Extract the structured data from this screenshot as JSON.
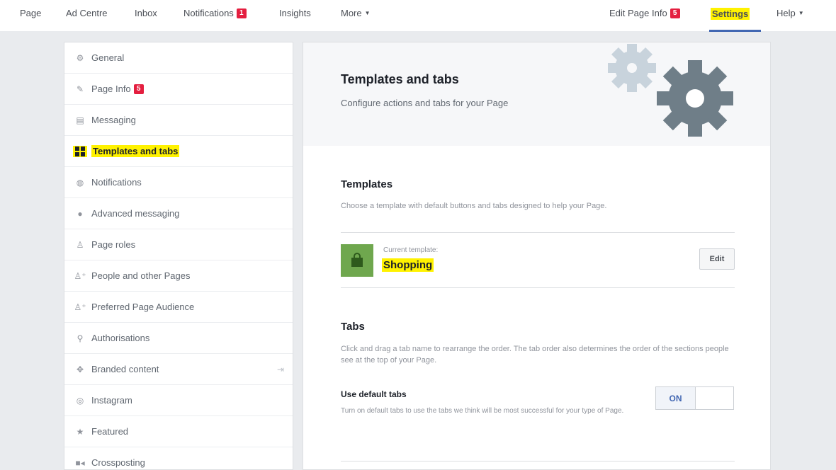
{
  "topnav": {
    "page": "Page",
    "ad_centre": "Ad Centre",
    "inbox": "Inbox",
    "notifications": "Notifications",
    "notifications_badge": "1",
    "insights": "Insights",
    "more": "More",
    "edit_page_info": "Edit Page Info",
    "edit_page_info_badge": "5",
    "settings": "Settings",
    "help": "Help"
  },
  "sidebar": {
    "items": [
      {
        "label": "General",
        "icon": "gear-icon"
      },
      {
        "label": "Page Info",
        "icon": "pencil-icon",
        "badge": "5"
      },
      {
        "label": "Messaging",
        "icon": "messaging-icon"
      },
      {
        "label": "Templates and tabs",
        "icon": "grid-icon",
        "active": true
      },
      {
        "label": "Notifications",
        "icon": "globe-icon"
      },
      {
        "label": "Advanced messaging",
        "icon": "chat-bubble-icon"
      },
      {
        "label": "Page roles",
        "icon": "person-icon"
      },
      {
        "label": "People and other Pages",
        "icon": "person-plus-icon"
      },
      {
        "label": "Preferred Page Audience",
        "icon": "person-plus-icon"
      },
      {
        "label": "Authorisations",
        "icon": "wrench-icon"
      },
      {
        "label": "Branded content",
        "icon": "handshake-icon"
      },
      {
        "label": "Instagram",
        "icon": "instagram-icon"
      },
      {
        "label": "Featured",
        "icon": "star-icon"
      },
      {
        "label": "Crossposting",
        "icon": "video-camera-icon"
      }
    ]
  },
  "main": {
    "title": "Templates and tabs",
    "subtitle": "Configure actions and tabs for your Page",
    "templates": {
      "title": "Templates",
      "description": "Choose a template with default buttons and tabs designed to help your Page.",
      "current_caption": "Current template:",
      "current_name": "Shopping",
      "edit_label": "Edit"
    },
    "tabs": {
      "title": "Tabs",
      "description": "Click and drag a tab name to rearrange the order. The tab order also determines the order of the sections people see at the top of your Page.",
      "default_label": "Use default tabs",
      "default_description": "Turn on default tabs to use the tabs we think will be most successful for your type of Page.",
      "toggle_state": "ON"
    }
  },
  "colors": {
    "highlight": "#fff200",
    "badge": "#e41e3f",
    "accent": "#4267b2",
    "template_thumb": "#6fa74e"
  }
}
